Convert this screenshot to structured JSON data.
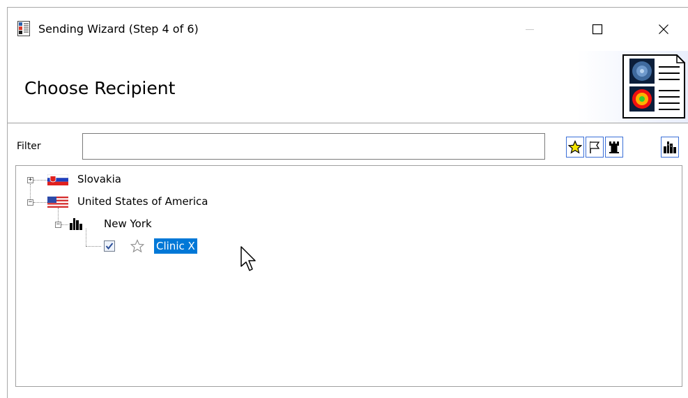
{
  "window": {
    "title": "Sending Wizard (Step 4 of 6)",
    "controls": {
      "minimize": "minimize-icon",
      "maximize": "maximize-icon",
      "close": "close-icon"
    }
  },
  "header": {
    "title": "Choose Recipient",
    "icon": "document-scan-icon"
  },
  "filter": {
    "label": "Filter",
    "value": "",
    "placeholder": ""
  },
  "toolbar": [
    {
      "icon": "star-icon",
      "active": true
    },
    {
      "icon": "flag-icon",
      "active": false
    },
    {
      "icon": "tower-icon",
      "active": false
    },
    {
      "icon": "city-icon",
      "active": false
    }
  ],
  "tree": {
    "nodes": [
      {
        "label": "Slovakia",
        "icon": "flag-slovakia-icon",
        "expanded": false
      },
      {
        "label": "United States of America",
        "icon": "flag-usa-icon",
        "expanded": true
      },
      {
        "label": "New York",
        "icon": "city-icon",
        "expanded": true
      },
      {
        "label": "Clinic X",
        "icon": "star-outline-icon",
        "checked": true,
        "selected": true
      }
    ]
  },
  "colors": {
    "selection": "#0078d7",
    "tool_border": "#3a6fd8",
    "star_fill": "#f5e600"
  }
}
